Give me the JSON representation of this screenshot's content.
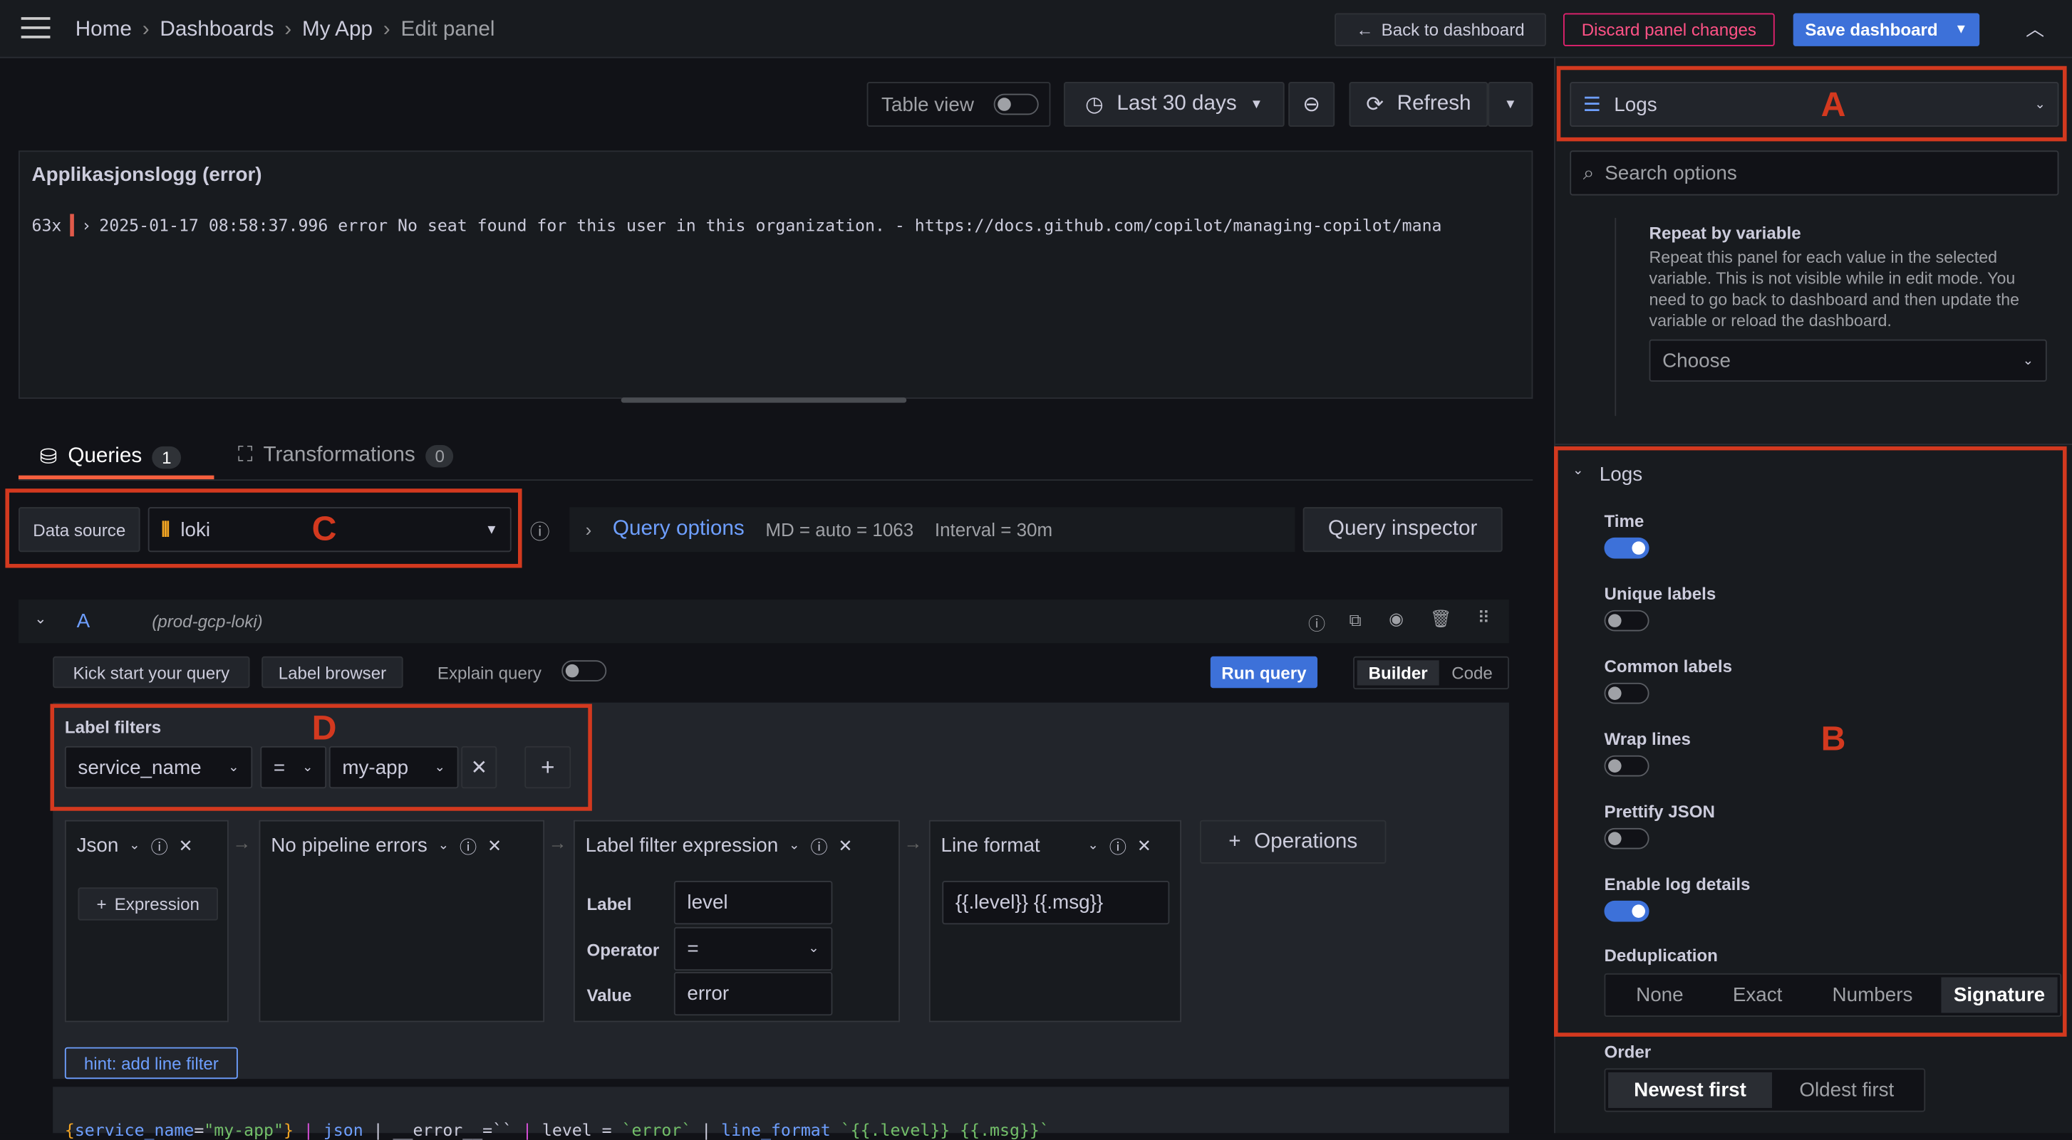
{
  "topbar": {
    "breadcrumb": [
      "Home",
      "Dashboards",
      "My App",
      "Edit panel"
    ],
    "back": "Back to dashboard",
    "discard": "Discard panel changes",
    "save": "Save dashboard"
  },
  "toolbar": {
    "table_view": "Table view",
    "time_range": "Last 30 days",
    "refresh": "Refresh"
  },
  "panel": {
    "title": "Applikasjonslogg (error)",
    "log": {
      "count": "63x",
      "text": "2025-01-17 08:58:37.996 error No seat found for this user in this organization. - https://docs.github.com/copilot/managing-copilot/mana"
    }
  },
  "tabs": [
    {
      "label": "Queries",
      "count": "1"
    },
    {
      "label": "Transformations",
      "count": "0"
    }
  ],
  "datasource": {
    "label": "Data source",
    "value": "loki",
    "query_options": "Query options",
    "md": "MD = auto = 1063",
    "interval": "Interval = 30m",
    "inspector": "Query inspector"
  },
  "query": {
    "ref": "A",
    "ds": "(prod-gcp-loki)",
    "kick": "Kick start your query",
    "label_browser": "Label browser",
    "explain": "Explain query",
    "run": "Run query",
    "modes": [
      "Builder",
      "Code"
    ],
    "active_mode": "Builder",
    "label_filters": {
      "title": "Label filters",
      "key": "service_name",
      "op": "=",
      "value": "my-app"
    },
    "ops": {
      "json": "Json",
      "expression": "Expression",
      "no_errors": "No pipeline errors",
      "lfe": "Label filter expression",
      "lfe_label": "Label",
      "lfe_label_val": "level",
      "lfe_operator": "Operator",
      "lfe_operator_val": "=",
      "lfe_value": "Error",
      "lfe_value_label": "Value",
      "lfe_value_val": "error",
      "line_format": "Line format",
      "line_format_val": "{{.level}} {{.msg}}",
      "operations": "Operations"
    },
    "hint": "hint: add line filter",
    "code": [
      "{",
      "service_name",
      "=",
      "\"my-app\"",
      "}",
      " | ",
      "json",
      " | ",
      "__error__=``",
      " | ",
      "level = ",
      "`error`",
      " | ",
      "line_format",
      " `{{.level}} {{.msg}}`"
    ]
  },
  "sidebar": {
    "viz": "Logs",
    "search_placeholder": "Search options",
    "repeat_title": "Repeat by variable",
    "repeat_desc": "Repeat this panel for each value in the selected variable. This is not visible while in edit mode. You need to go back to dashboard and then update the variable or reload the dashboard.",
    "choose": "Choose",
    "logs_title": "Logs",
    "toggles": [
      {
        "label": "Time",
        "on": true
      },
      {
        "label": "Unique labels",
        "on": false
      },
      {
        "label": "Common labels",
        "on": false
      },
      {
        "label": "Wrap lines",
        "on": false
      },
      {
        "label": "Prettify JSON",
        "on": false
      },
      {
        "label": "Enable log details",
        "on": true
      }
    ],
    "dedup_label": "Deduplication",
    "dedup": [
      "None",
      "Exact",
      "Numbers",
      "Signature"
    ],
    "dedup_selected": "Signature",
    "order_label": "Order",
    "order": [
      "Newest first",
      "Oldest first"
    ],
    "order_selected": "Newest first"
  },
  "annotations": {
    "a": "A",
    "b": "B",
    "c": "C",
    "d": "D"
  },
  "colors": {
    "accent": "#3d71d9",
    "danger": "#d3391f",
    "link": "#6e9fff"
  }
}
